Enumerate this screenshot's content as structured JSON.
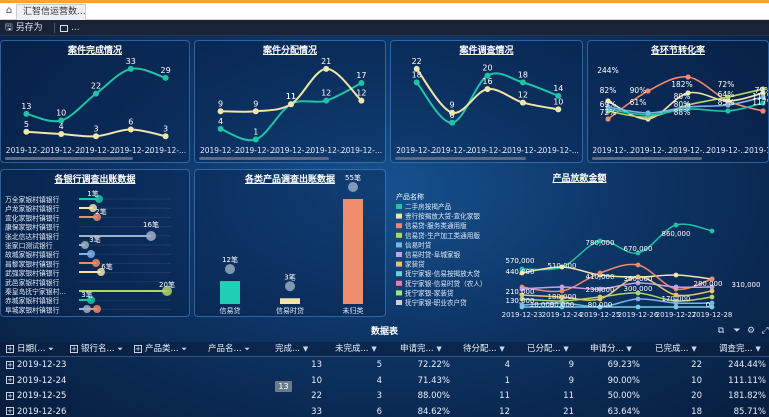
{
  "tab": {
    "title": "汇智信运营数..."
  },
  "toolbar": {
    "save_as": "另存为",
    "more": "..."
  },
  "panels": {
    "case_complete": "案件完成情况",
    "case_assign": "案件分配情况",
    "case_survey": "案件调查情况",
    "conversion": "各环节转化率",
    "bank_survey": "各银行调查出账数据",
    "product_type": "各类产品调查出账数据",
    "product_amount": "产品放款金额",
    "table": "数据表"
  },
  "xdate": "2019-12-...",
  "chart_data": [
    {
      "type": "line",
      "title": "案件完成情况",
      "categories": [
        "2019-12-...",
        "2019-12-...",
        "2019-12-...",
        "2019-12-...",
        "2019-12-..."
      ],
      "series": [
        {
          "name": "",
          "color": "#1fc3a5",
          "values": [
            13,
            10,
            22,
            33,
            29
          ]
        },
        {
          "name": "",
          "color": "#f2e6a8",
          "values": [
            5,
            4,
            3,
            6,
            3
          ]
        }
      ]
    },
    {
      "type": "line",
      "title": "案件分配情况",
      "categories": [
        "2019-12-...",
        "2019-12-...",
        "2019-12-...",
        "2019-12-...",
        "2019-12-..."
      ],
      "series": [
        {
          "name": "",
          "color": "#1fc3a5",
          "values": [
            4,
            1,
            11,
            12,
            17
          ]
        },
        {
          "name": "",
          "color": "#f2e6a8",
          "values": [
            9,
            9,
            11,
            21,
            12
          ]
        }
      ]
    },
    {
      "type": "line",
      "title": "案件调查情况",
      "categories": [
        "2019-12-...",
        "2019-12-...",
        "2019-12-...",
        "2019-12-...",
        "2019-12-..."
      ],
      "series": [
        {
          "name": "",
          "color": "#1fc3a5",
          "values": [
            18,
            6,
            20,
            18,
            14
          ]
        },
        {
          "name": "",
          "color": "#f2e6a8",
          "values": [
            22,
            9,
            16,
            12,
            10
          ]
        }
      ]
    },
    {
      "type": "line",
      "title": "各环节转化率",
      "categories": [
        "2019-12-...",
        "2019-12-...",
        "2019-12-...",
        "2019-12-...",
        "2019-12-..."
      ],
      "labels": [
        "244%",
        "90%",
        "182%",
        "72%",
        "79%",
        "82%",
        "69%",
        "80%",
        "80%",
        "64%",
        "111%",
        "72%",
        "61%",
        "88%",
        "85%",
        "117%"
      ]
    },
    {
      "type": "scatter",
      "title": "各银行调查出账数据",
      "categories": [
        "万全家银村镇银行",
        "卢龙家银村镇银行",
        "宣化家银村镇银行",
        "康保家银村镇银行",
        "张北信达村镇银行",
        "张家口测试银行",
        "故城家银村镇银行",
        "昌黎家银村镇银行",
        "武强家银村镇银行",
        "武邑家银村镇银行",
        "秦皇岛抚宁家银村...",
        "赤城家银村镇银行",
        "阜城家银村镇银行"
      ],
      "labels": [
        "1笔",
        "2笔",
        "16笔",
        "3笔",
        "6笔",
        "20笔",
        "3笔"
      ]
    },
    {
      "type": "bar",
      "title": "各类产品调查出账数据",
      "categories": [
        "信易贷",
        "信易时贷",
        "未归类"
      ],
      "values": [
        12,
        3,
        55
      ],
      "value_labels": [
        "12笔",
        "3笔",
        "55笔"
      ]
    },
    {
      "type": "line",
      "title": "产品放款金额",
      "legend_title": "产品名称",
      "legend": [
        "二手房按揭产品",
        "壹行按揭放大贷-宣化家银",
        "信易贷-服务类通用版",
        "信易贷-生产加工类通用版",
        "信易时贷",
        "信易时贷-阜城家银",
        "家装贷",
        "抚宁家银-信易按揭放大贷",
        "抚宁家银-信易时贷（农人）",
        "抚宁家银-家装贷",
        "抚宁家银-职业农户贷"
      ],
      "categories": [
        "2019-12-23",
        "2019-12-24",
        "2019-12-25",
        "2019-12-26",
        "2019-12-27",
        "2019-12-28"
      ],
      "labels": [
        "570,000",
        "440,000",
        "510,000",
        "780,000",
        "670,000",
        "860,000",
        "410,000",
        "360,000",
        "300,000",
        "280,000",
        "310,000",
        "230,000",
        "210,000",
        "180,000",
        "170,000",
        "130,000",
        "10,000",
        "90,000",
        "80,000",
        "0"
      ]
    }
  ],
  "table": {
    "headers": [
      "日期(...",
      "银行名...",
      "产品类...",
      "产品名...",
      "完成...",
      "未完成...",
      "申请完...",
      "待分配...",
      "已分配...",
      "申请分...",
      "已完成...",
      "调查完..."
    ],
    "rows": [
      [
        "2019-12-23",
        "",
        "",
        "",
        "13",
        "5",
        "72.22%",
        "4",
        "9",
        "69.23%",
        "22",
        "244.44%"
      ],
      [
        "2019-12-24",
        "",
        "",
        "",
        "10",
        "4",
        "71.43%",
        "1",
        "9",
        "90.00%",
        "10",
        "111.11%"
      ],
      [
        "2019-12-25",
        "",
        "",
        "",
        "22",
        "3",
        "88.00%",
        "11",
        "11",
        "50.00%",
        "20",
        "181.82%"
      ],
      [
        "2019-12-26",
        "",
        "",
        "",
        "33",
        "6",
        "84.62%",
        "12",
        "21",
        "63.64%",
        "18",
        "85.71%"
      ]
    ],
    "badge": "13"
  }
}
